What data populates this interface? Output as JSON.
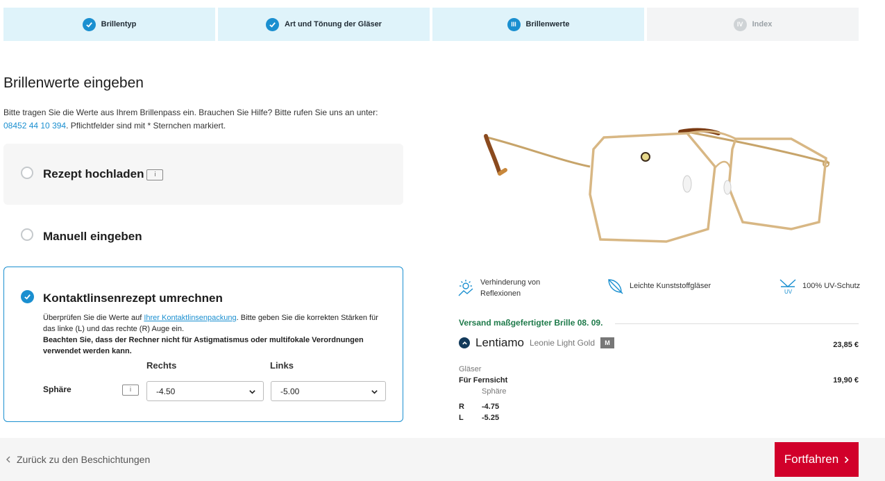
{
  "stepper": [
    {
      "label": "Brillentyp",
      "state": "done",
      "marker": ""
    },
    {
      "label": "Art und Tönung der Gläser",
      "state": "done",
      "marker": ""
    },
    {
      "label": "Brillenwerte",
      "state": "current",
      "marker": "III"
    },
    {
      "label": "Index",
      "state": "todo",
      "marker": "IV"
    }
  ],
  "page": {
    "title": "Brillenwerte eingeben",
    "intro_text": "Bitte tragen Sie die Werte aus Ihrem Brillenpass ein. Brauchen Sie Hilfe? Bitte rufen Sie uns an unter:",
    "phone": "08452 44 10 394",
    "intro_text2": ". Pflichtfelder sind mit * Sternchen markiert."
  },
  "options": {
    "upload": {
      "label": "Rezept hochladen",
      "info": "i"
    },
    "manual": {
      "label": "Manuell eingeben"
    },
    "contact": {
      "label": "Kontaktlinsenrezept umrechnen",
      "text1": "Überprüfen Sie die Werte auf ",
      "link": "Ihrer Kontaktlinsenpackung",
      "text2": ". Bitte geben Sie die korrekten Stärken für das linke (L) und das rechte (R) Auge ein.",
      "warning": "Beachten Sie, dass der Rechner nicht für Astigmatismus oder multifokale Verordnungen verwendet werden kann.",
      "col_right": "Rechts",
      "col_left": "Links",
      "row_label": "Sphäre",
      "info": "i",
      "right_value": "-4.50",
      "left_value": "-5.00"
    }
  },
  "features": [
    {
      "label": "Verhinderung von Reflexionen",
      "icon": "sun-reflection-icon"
    },
    {
      "label": "Leichte Kunststoffgläser",
      "icon": "feather-icon"
    },
    {
      "label": "100% UV-Schutz",
      "icon": "uv-icon"
    }
  ],
  "summary": {
    "shipping": "Versand maßgefertigter Brille 08. 09.",
    "brand": "Lentiamo",
    "model": "Leonie Light Gold",
    "size": "M",
    "price": "23,85 €",
    "lenses_label": "Gläser",
    "lens_type": "Für Fernsicht",
    "lens_price": "19,90 €",
    "sphere_label": "Sphäre",
    "r_label": "R",
    "r_value": "-4.75",
    "l_label": "L",
    "l_value": "-5.25"
  },
  "footer": {
    "back_label": "Zurück zu den Beschichtungen",
    "continue_label": "Fortfahren"
  },
  "colors": {
    "accent": "#1a8fd0",
    "primary_button": "#d1002a",
    "shipping_green": "#1e7a4a"
  }
}
